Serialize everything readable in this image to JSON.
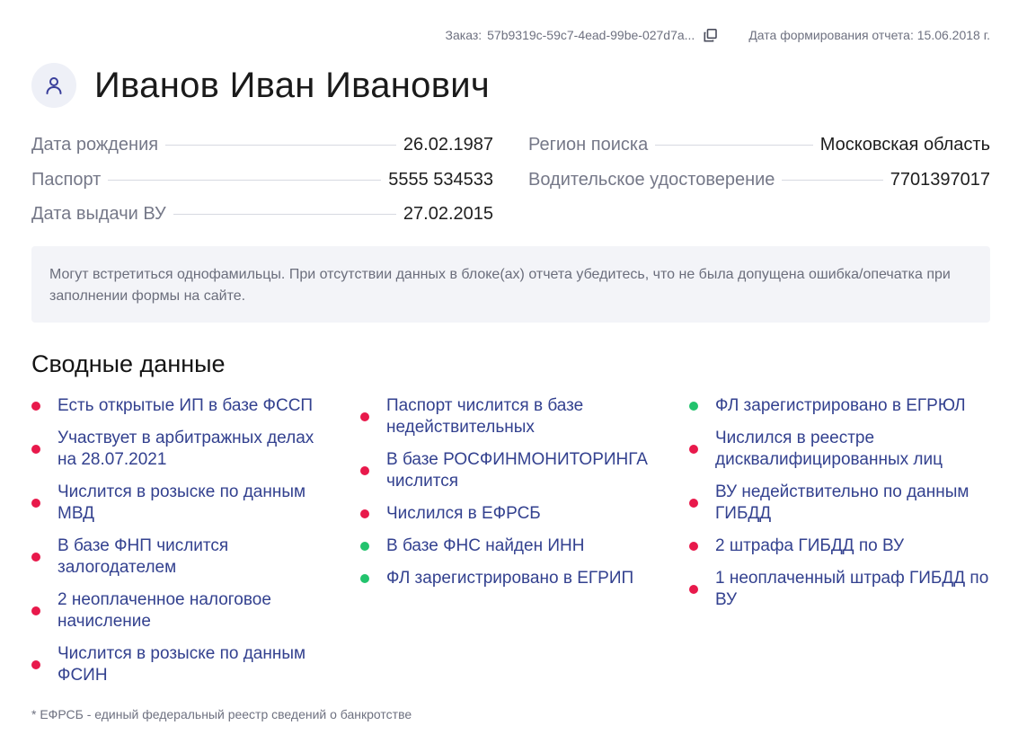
{
  "meta": {
    "order_label": "Заказ:",
    "order_id": "57b9319c-59c7-4ead-99be-027d7a...",
    "report_date": "Дата формирования отчета: 15.06.2018 г."
  },
  "person": {
    "full_name": "Иванов Иван Иванович"
  },
  "info": {
    "left": [
      {
        "label": "Дата рождения",
        "value": "26.02.1987"
      },
      {
        "label": "Паспорт",
        "value": "5555 534533"
      },
      {
        "label": "Дата выдачи ВУ",
        "value": "27.02.2015"
      }
    ],
    "right": [
      {
        "label": "Регион поиска",
        "value": "Московская область"
      },
      {
        "label": "Водительское удостоверение",
        "value": "7701397017"
      }
    ]
  },
  "notice": {
    "text": "Могут встретиться однофамильцы. При отсутствии данных в блоке(ах) отчета убедитесь, что не была допущена ошибка/опечатка при заполнении формы на сайте."
  },
  "summary": {
    "title": "Сводные данные",
    "columns": [
      [
        {
          "text": "Есть открытые ИП в базе ФССП",
          "status": "red"
        },
        {
          "text": "Участвует в арбитражных делах на 28.07.2021",
          "status": "red"
        },
        {
          "text": "Числится в розыске по данным МВД",
          "status": "red"
        },
        {
          "text": "В базе ФНП числится залогодателем",
          "status": "red"
        },
        {
          "text": "2 неоплаченное налоговое начисление",
          "status": "red"
        },
        {
          "text": "Числится в розыске по данным ФСИН",
          "status": "red"
        }
      ],
      [
        {
          "text": "Паспорт числится в базе недействительных",
          "status": "red"
        },
        {
          "text": "В базе РОСФИНМОНИТОРИНГА числится",
          "status": "red"
        },
        {
          "text": "Числился в ЕФРСБ",
          "status": "red"
        },
        {
          "text": "В базе ФНС найден ИНН",
          "status": "green"
        },
        {
          "text": "ФЛ зарегистрировано в ЕГРИП",
          "status": "green"
        }
      ],
      [
        {
          "text": "ФЛ зарегистрировано в ЕГРЮЛ",
          "status": "green"
        },
        {
          "text": "Числился в реестре дисквалифицированных лиц",
          "status": "red"
        },
        {
          "text": "ВУ недействительно по данным ГИБДД",
          "status": "red"
        },
        {
          "text": "2 штрафа ГИБДД по ВУ",
          "status": "red"
        },
        {
          "text": "1 неоплаченный штраф ГИБДД по ВУ",
          "status": "red"
        }
      ]
    ]
  },
  "footnote": "* ЕФРСБ - единый федеральный реестр сведений о банкротстве",
  "colors": {
    "accent": "#33418f",
    "status_red": "#e8194b",
    "status_green": "#22c36d",
    "notice_bg": "#f3f4f8"
  }
}
